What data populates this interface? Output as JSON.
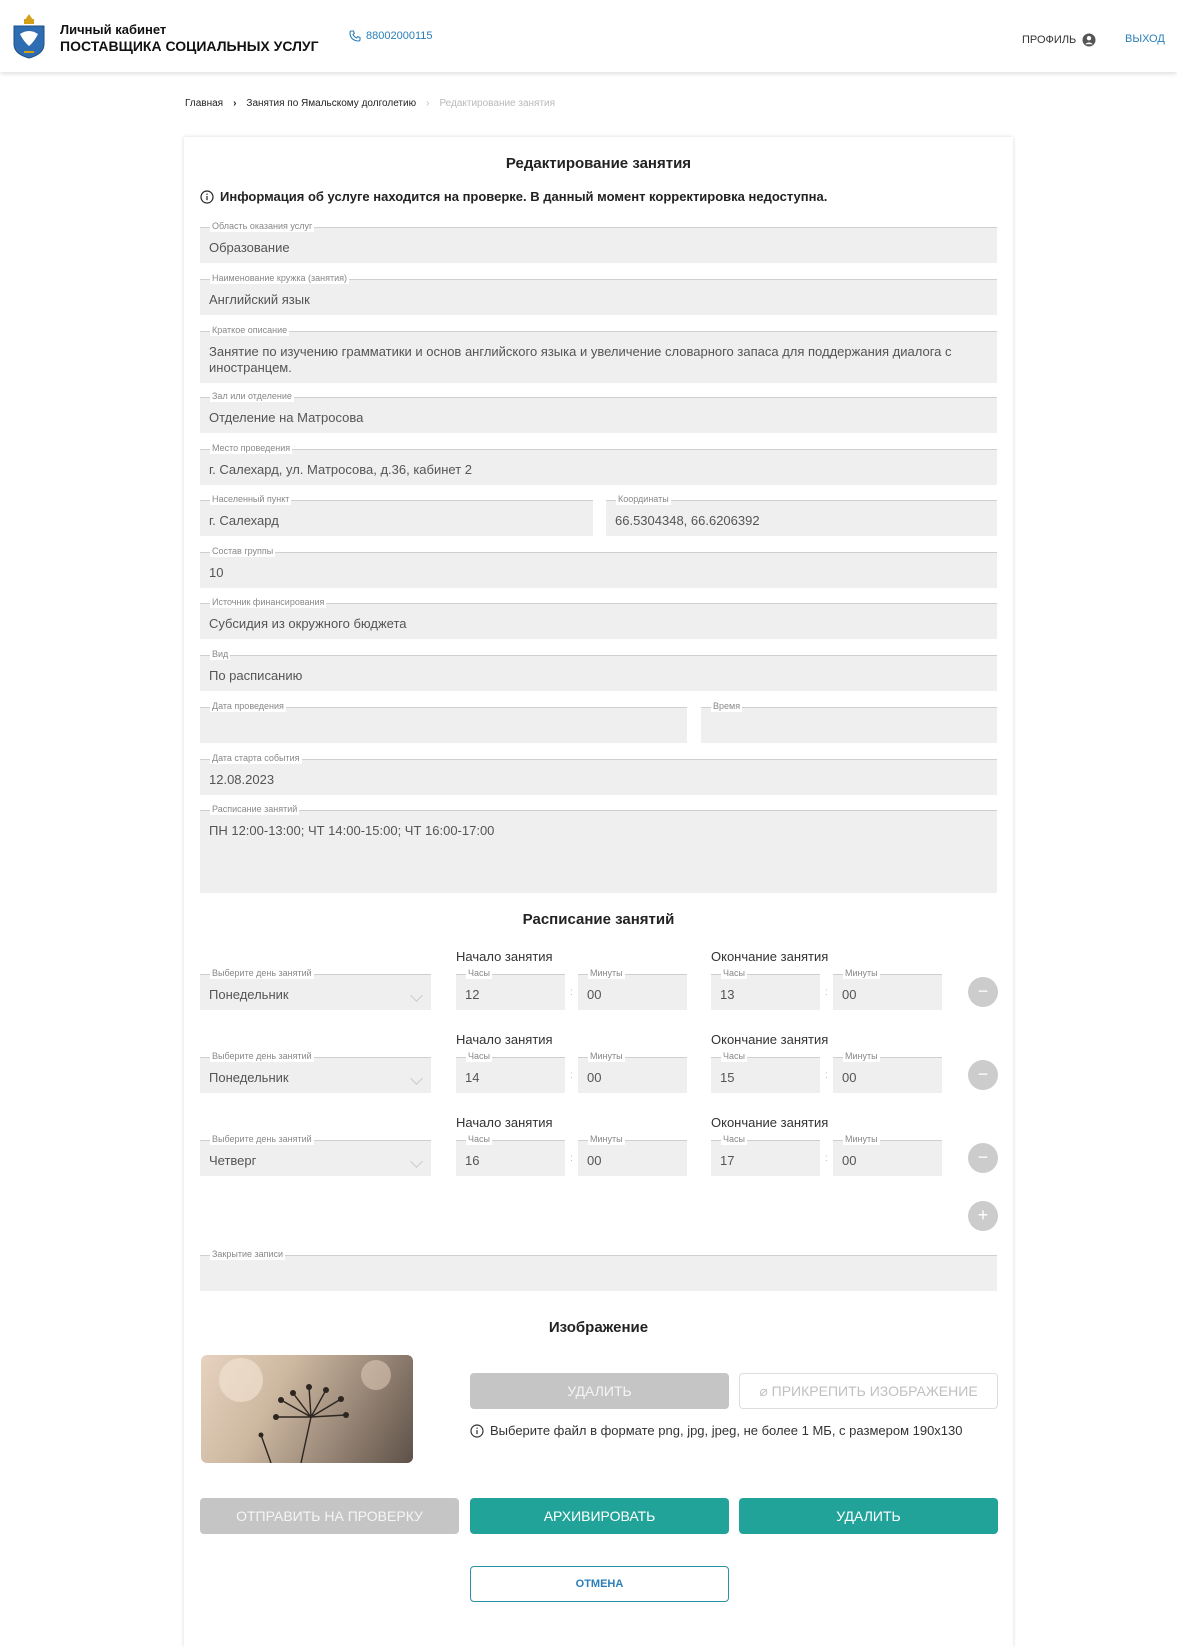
{
  "header": {
    "brand_line1": "Личный кабинет",
    "brand_line2": "ПОСТАВЩИКА СОЦИАЛЬНЫХ УСЛУГ",
    "phone": "88002000115",
    "profile_label": "ПРОФИЛЬ",
    "logout_label": "ВЫХОД"
  },
  "breadcrumbs": {
    "home": "Главная",
    "section": "Занятия по Ямальскому долголетию",
    "current": "Редактирование занятия"
  },
  "form": {
    "title": "Редактирование занятия",
    "notice": "Информация об услуге находится на проверке. В данный момент корректировка недоступна.",
    "fields": {
      "area": {
        "label": "Область оказания услуг",
        "value": "Образование"
      },
      "name": {
        "label": "Наименование кружка (занятия)",
        "value": "Английский язык"
      },
      "description": {
        "label": "Краткое описание",
        "value": "Занятие по изучению грамматики и основ английского языка и увеличение словарного запаса для поддержания диалога с иностранцем."
      },
      "hall": {
        "label": "Зал или отделение",
        "value": "Отделение на Матросова"
      },
      "place": {
        "label": "Место проведения",
        "value": "г. Салехард, ул. Матросова, д.36, кабинет 2"
      },
      "locality": {
        "label": "Населенный пункт",
        "value": "г. Салехард"
      },
      "coords": {
        "label": "Координаты",
        "value": "66.5304348, 66.6206392"
      },
      "group": {
        "label": "Состав группы",
        "value": "10"
      },
      "funding": {
        "label": "Источник финансирования",
        "value": "Субсидия из окружного бюджета"
      },
      "kind": {
        "label": "Вид",
        "value": "По расписанию"
      },
      "date": {
        "label": "Дата проведения",
        "value": ""
      },
      "time": {
        "label": "Время",
        "value": ""
      },
      "start_date": {
        "label": "Дата старта события",
        "value": "12.08.2023"
      },
      "schedule_text": {
        "label": "Расписание занятий",
        "value": "ПН 12:00-13:00; ЧТ 14:00-15:00; ЧТ 16:00-17:00"
      },
      "closing": {
        "label": "Закрытие записи",
        "value": ""
      }
    },
    "schedule": {
      "title": "Расписание занятий",
      "start_heading": "Начало занятия",
      "end_heading": "Окончание занятия",
      "day_label": "Выберите день занятий",
      "hours_label": "Часы",
      "minutes_label": "Минуты",
      "colon": ":",
      "remove_symbol": "−",
      "add_symbol": "+",
      "rows": [
        {
          "day": "Понедельник",
          "start_h": "12",
          "start_m": "00",
          "end_h": "13",
          "end_m": "00"
        },
        {
          "day": "Понедельник",
          "start_h": "14",
          "start_m": "00",
          "end_h": "15",
          "end_m": "00"
        },
        {
          "day": "Четверг",
          "start_h": "16",
          "start_m": "00",
          "end_h": "17",
          "end_m": "00"
        }
      ]
    },
    "image": {
      "title": "Изображение",
      "delete_label": "УДАЛИТЬ",
      "attach_label": "ПРИКРЕПИТЬ ИЗОБРАЖЕНИЕ",
      "hint": "Выберите файл в формате png, jpg, jpeg, не более 1 МБ, с размером 190х130"
    },
    "actions": {
      "send_label": "ОТПРАВИТЬ НА ПРОВЕРКУ",
      "archive_label": "АРХИВИРОВАТЬ",
      "delete_label": "УДАЛИТЬ",
      "cancel_label": "ОТМЕНА"
    }
  },
  "colors": {
    "accent": "#22a39a",
    "link": "#2a7fb8",
    "disabled_button": "#c5c5c5",
    "field_bg": "#efefef"
  },
  "icons": [
    "coat-of-arms-logo",
    "phone-icon",
    "user-icon",
    "info-icon",
    "chevron-down-icon",
    "remove-icon",
    "add-icon",
    "paperclip-icon"
  ]
}
